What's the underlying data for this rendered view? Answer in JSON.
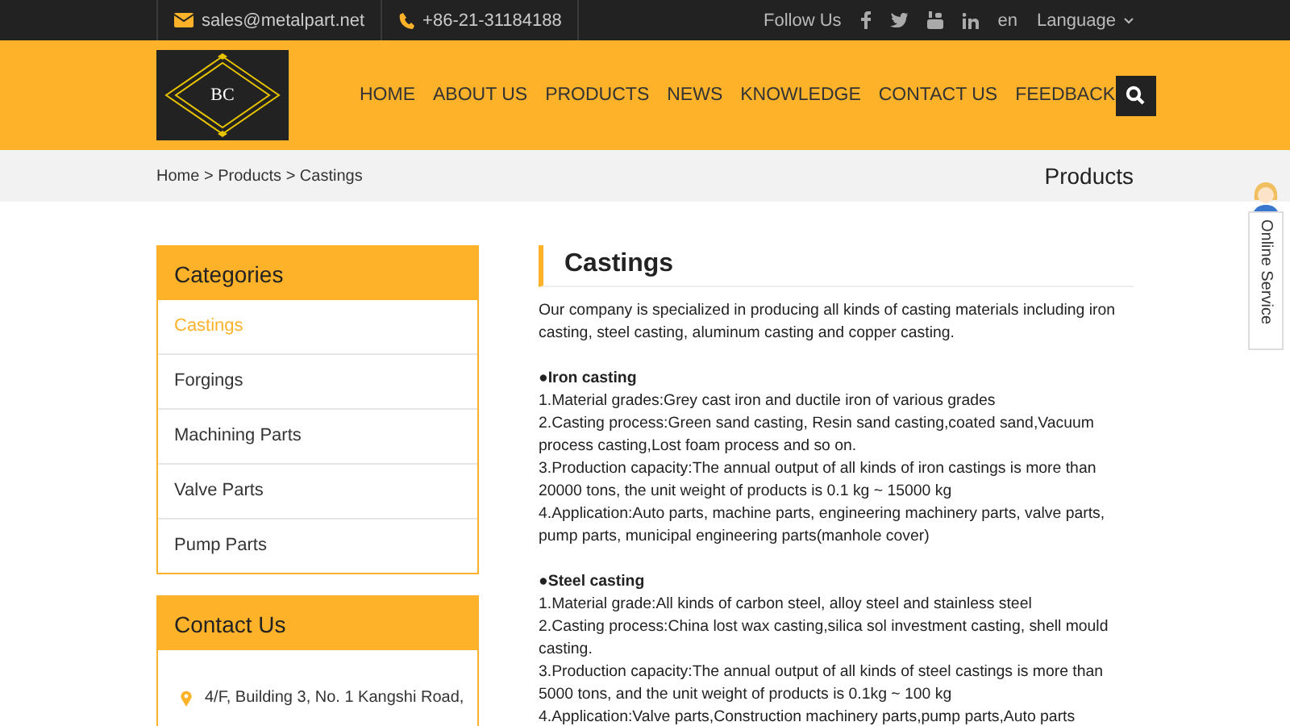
{
  "top_bar": {
    "email": "sales@metalpart.net",
    "phone": "+86-21-31184188",
    "follow_label": "Follow Us",
    "language_code": "en",
    "language_label": "Language"
  },
  "logo": {
    "initials": "BC"
  },
  "nav": [
    {
      "label": "HOME",
      "selected": false
    },
    {
      "label": "ABOUT US",
      "selected": false
    },
    {
      "label": "PRODUCTS",
      "selected": false
    },
    {
      "label": "NEWS",
      "selected": false
    },
    {
      "label": "KNOWLEDGE",
      "selected": false
    },
    {
      "label": "CONTACT US",
      "selected": false
    },
    {
      "label": "FEEDBACK",
      "selected": false
    }
  ],
  "breadcrumb": {
    "path": "Home > Products > Castings",
    "section_title": "Products"
  },
  "sidebar": {
    "categories_title": "Categories",
    "categories": [
      {
        "label": "Castings",
        "selected": true
      },
      {
        "label": "Forgings",
        "selected": false
      },
      {
        "label": "Machining Parts",
        "selected": false
      },
      {
        "label": "Valve Parts",
        "selected": false
      },
      {
        "label": "Pump Parts",
        "selected": false
      }
    ],
    "contact_title": "Contact Us",
    "address": "4/F, Building 3, No. 1 Kangshi Road,"
  },
  "content": {
    "title": "Castings",
    "blocks": [
      {
        "kind": "paragraph",
        "text": "Our company is specialized in producing all kinds of casting materials including iron casting, steel casting, aluminum casting and copper casting."
      },
      {
        "kind": "spacer"
      },
      {
        "kind": "heading",
        "text": "●Iron casting"
      },
      {
        "kind": "paragraph",
        "text": "1.Material grades:Grey cast iron and ductile iron of various grades"
      },
      {
        "kind": "paragraph",
        "text": "2.Casting process:Green sand casting, Resin sand casting,coated sand,Vacuum process casting,Lost foam process and so on."
      },
      {
        "kind": "paragraph",
        "text": "3.Production capacity:The annual output of all kinds of iron castings is more than 20000 tons, the unit weight of products is 0.1 kg ~ 15000 kg"
      },
      {
        "kind": "paragraph",
        "text": "4.Application:Auto parts, machine parts, engineering machinery parts, valve parts, pump parts, municipal engineering parts(manhole cover)"
      },
      {
        "kind": "spacer"
      },
      {
        "kind": "heading",
        "text": "●Steel casting"
      },
      {
        "kind": "paragraph",
        "text": "1.Material grade:All kinds of carbon steel, alloy steel and stainless steel"
      },
      {
        "kind": "paragraph",
        "text": "2.Casting process:China lost wax casting,silica sol investment casting, shell mould casting."
      },
      {
        "kind": "paragraph",
        "text": "3.Production capacity:The annual output of all kinds of steel castings is more than 5000 tons, and the unit weight of products is 0.1kg ~ 100 kg"
      },
      {
        "kind": "paragraph",
        "text": "4.Application:Valve parts,Construction machinery parts,pump parts,Auto parts"
      }
    ]
  },
  "online_service": {
    "label": "Online Service"
  }
}
